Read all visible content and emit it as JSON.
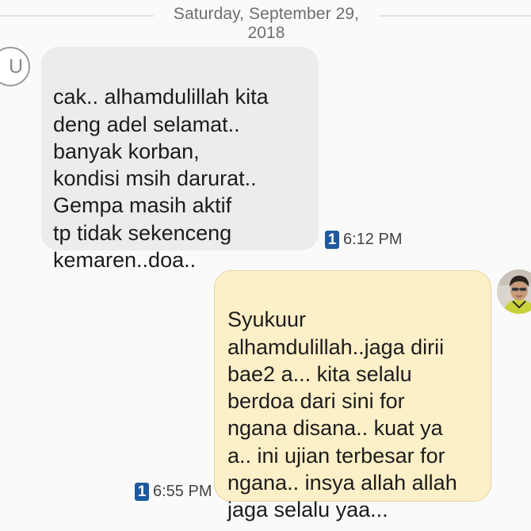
{
  "conversation": {
    "date_separator": "Saturday, September 29, 2018",
    "messages": [
      {
        "direction": "incoming",
        "avatar_letter": "U",
        "text": "cak.. alhamdulillah kita\ndeng adel selamat..\nbanyak korban,\nkondisi msih darurat..\nGempa masih aktif\ntp tidak sekenceng\nkemaren..doa..",
        "sim_slot": "1",
        "time": "6:12 PM"
      },
      {
        "direction": "outgoing",
        "text": "Syukuur\nalhamdulillah..jaga dirii\nbae2 a... kita selalu\nberdoa dari sini for\nngana disana.. kuat ya\na.. ini ujian terbesar for\nngana.. insya allah allah\njaga selalu yaa...",
        "sim_slot": "1",
        "time": "6:55 PM"
      }
    ]
  },
  "colors": {
    "incoming_bubble": "#ececec",
    "outgoing_bubble": "#fdefc7",
    "sim_badge": "#1e5a9e",
    "background": "#fafafa"
  },
  "icons": {
    "sim_badge": "sim-1-icon",
    "outgoing_avatar": "contact-photo-avatar"
  }
}
